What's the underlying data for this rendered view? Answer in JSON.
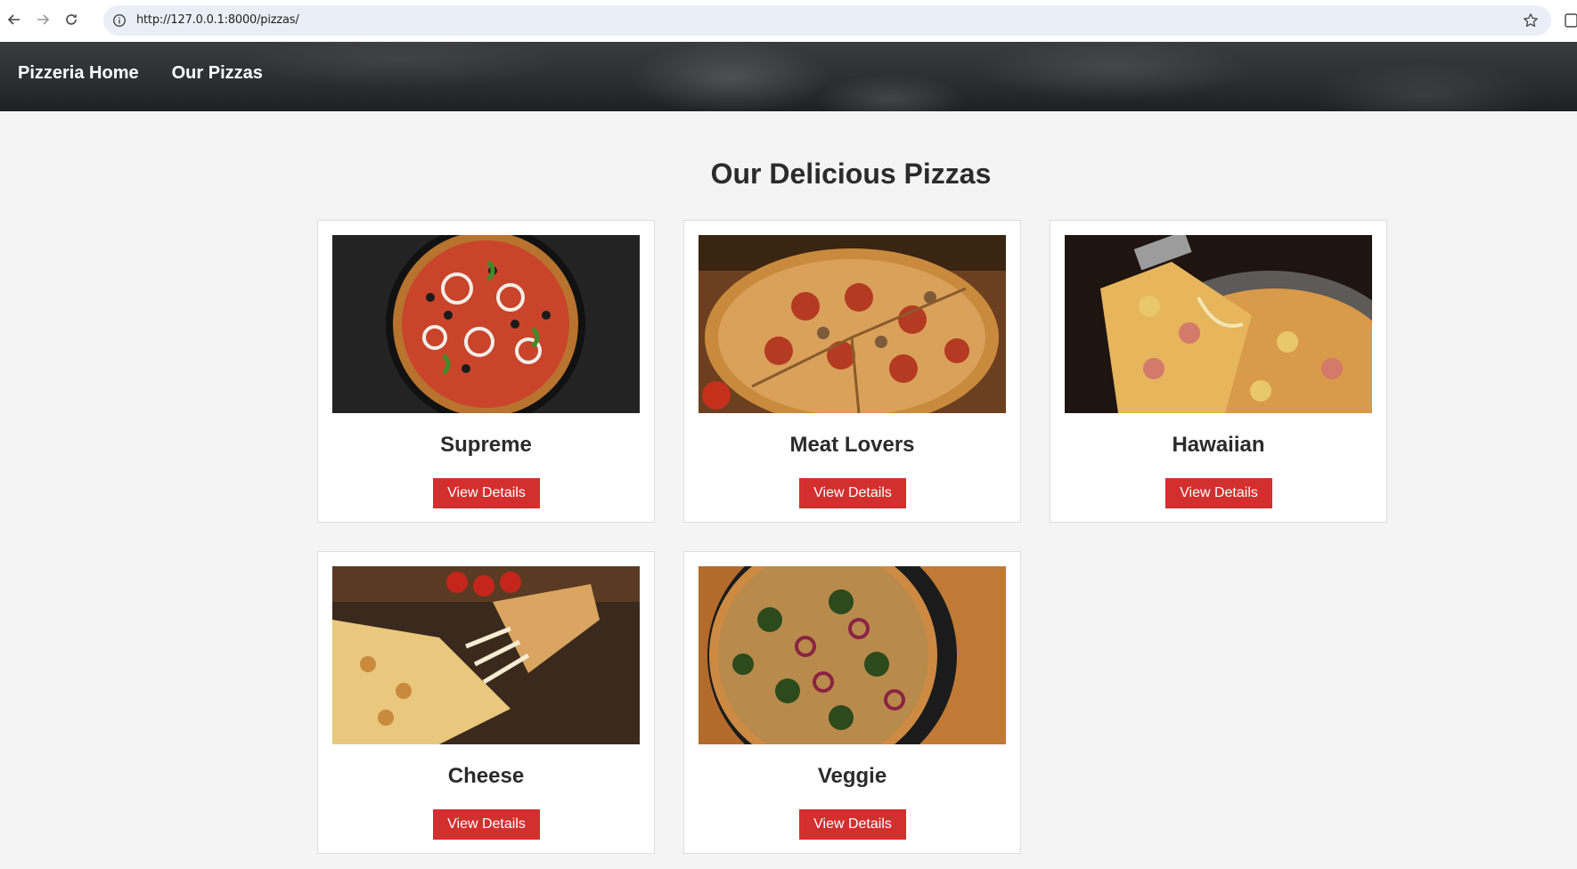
{
  "browser": {
    "url": "http://127.0.0.1:8000/pizzas/"
  },
  "nav": {
    "home": "Pizzeria Home",
    "pizzas": "Our Pizzas"
  },
  "main": {
    "title": "Our Delicious Pizzas",
    "pizzas": [
      {
        "name": "Supreme",
        "button": "View Details"
      },
      {
        "name": "Meat Lovers",
        "button": "View Details"
      },
      {
        "name": "Hawaiian",
        "button": "View Details"
      },
      {
        "name": "Cheese",
        "button": "View Details"
      },
      {
        "name": "Veggie",
        "button": "View Details"
      }
    ]
  },
  "colors": {
    "accent": "#d32f2f",
    "header_bg": "#2d2e30",
    "page_bg": "#f4f4f4"
  }
}
